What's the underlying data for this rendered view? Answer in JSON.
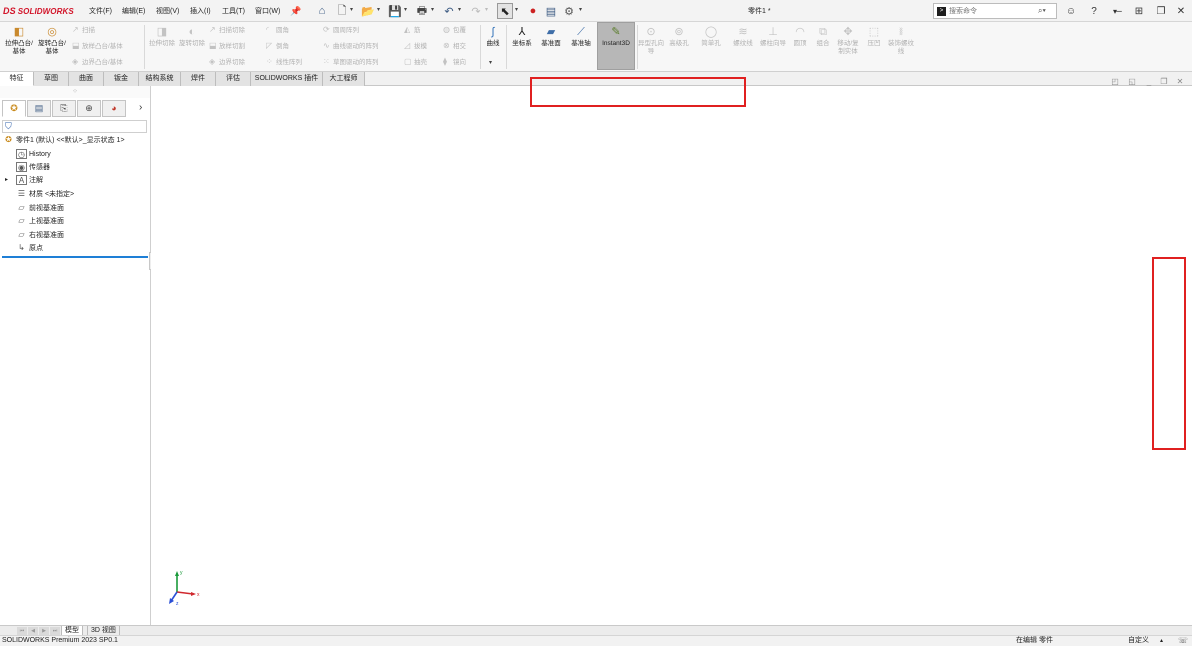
{
  "app": {
    "brand": "SOLIDWORKS",
    "brand_ds": "DS",
    "document_title": "零件1 *",
    "accent_color": "#d2152a",
    "highlight_color": "#e02020"
  },
  "menu": [
    "文件(F)",
    "编辑(E)",
    "视图(V)",
    "插入(I)",
    "工具(T)",
    "窗口(W)"
  ],
  "search": {
    "placeholder": "搜索命令"
  },
  "ribbon": {
    "extrude": "拉伸凸台/基体",
    "revolve": "旋转凸台/基体",
    "sweep": "扫描",
    "loft": "放样凸台/基体",
    "boundary": "边界凸台/基体",
    "extrude_cut": "拉伸切除",
    "revolve_cut": "旋转切除",
    "swept_cut": "扫描切除",
    "lofted_cut": "放样切割",
    "boundary_cut": "边界切除",
    "fillet": "圆角",
    "chamfer": "倒角",
    "linear_pattern": "线性阵列",
    "circular_pattern": "圆周阵列",
    "curve_pattern": "曲线驱动的阵列",
    "sketch_pattern": "草图驱动的阵列",
    "rib": "筋",
    "draft": "拔模",
    "shell": "抽壳",
    "wrap": "包覆",
    "intersect": "相交",
    "mirror": "镜向",
    "curves": "曲线",
    "coord": "坐标系",
    "plane": "基准面",
    "axis": "基准轴",
    "instant3d": "Instant3D",
    "hole_wizard": "异型孔向导",
    "advanced_hole": "高级孔",
    "simple_hole": "简单孔",
    "thread": "螺纹线",
    "stud": "螺柱向导",
    "dome": "圆顶",
    "combine": "组合",
    "move_copy": "移动/复制实体",
    "indent": "压凹",
    "cosmetic_thread": "装饰螺纹线"
  },
  "tabs": [
    "特征",
    "草图",
    "曲面",
    "钣金",
    "结构系统",
    "焊件",
    "评估",
    "SOLIDWORKS 插件",
    "大工程师"
  ],
  "tree": {
    "root": "零件1 (默认) <<默认>_显示状态 1>",
    "items": [
      "History",
      "传感器",
      "注解",
      "材质 <未指定>",
      "前视基准面",
      "上视基准面",
      "右视基准面",
      "原点"
    ]
  },
  "triad": {
    "x": "x",
    "y": "y",
    "z": "z"
  },
  "bottom_tabs": [
    "模型",
    "3D 视图"
  ],
  "status": {
    "product": "SOLIDWORKS Premium 2023 SP0.1",
    "editing": "在编辑 零件",
    "units": "自定义"
  }
}
